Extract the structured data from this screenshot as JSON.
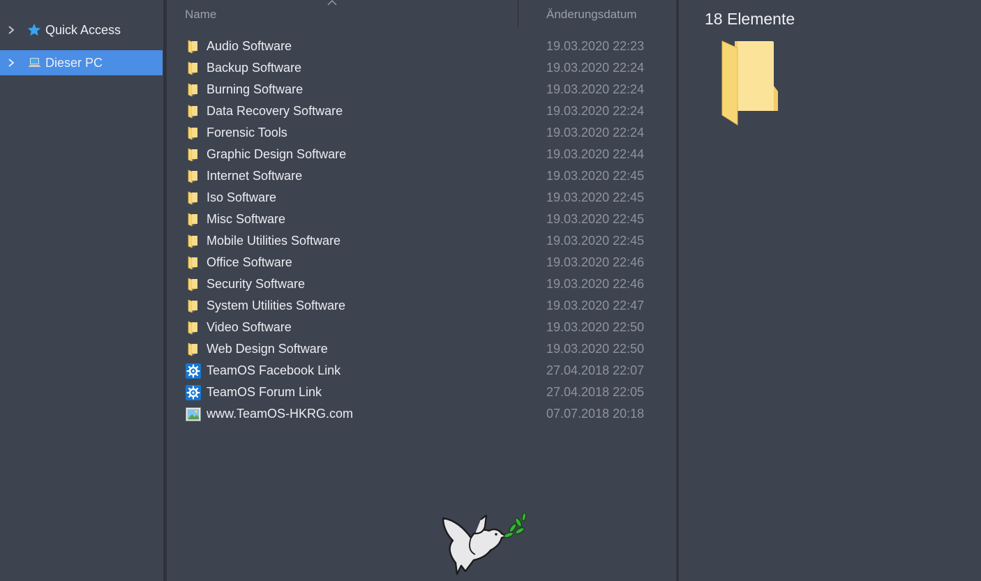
{
  "sidebar": {
    "items": [
      {
        "label": "Quick Access",
        "icon": "star-icon",
        "selected": false
      },
      {
        "label": "Dieser PC",
        "icon": "computer-icon",
        "selected": true
      }
    ]
  },
  "list": {
    "columns": {
      "name": "Name",
      "date": "Änderungsdatum"
    },
    "rows": [
      {
        "name": "Audio Software",
        "date": "19.03.2020 22:23",
        "type": "folder"
      },
      {
        "name": "Backup Software",
        "date": "19.03.2020 22:24",
        "type": "folder"
      },
      {
        "name": "Burning Software",
        "date": "19.03.2020 22:24",
        "type": "folder"
      },
      {
        "name": "Data Recovery Software",
        "date": "19.03.2020 22:24",
        "type": "folder"
      },
      {
        "name": "Forensic Tools",
        "date": "19.03.2020 22:24",
        "type": "folder"
      },
      {
        "name": "Graphic Design Software",
        "date": "19.03.2020 22:44",
        "type": "folder"
      },
      {
        "name": "Internet Software",
        "date": "19.03.2020 22:45",
        "type": "folder"
      },
      {
        "name": "Iso Software",
        "date": "19.03.2020 22:45",
        "type": "folder"
      },
      {
        "name": "Misc Software",
        "date": "19.03.2020 22:45",
        "type": "folder"
      },
      {
        "name": "Mobile Utilities Software",
        "date": "19.03.2020 22:45",
        "type": "folder"
      },
      {
        "name": "Office Software",
        "date": "19.03.2020 22:46",
        "type": "folder"
      },
      {
        "name": "Security Software",
        "date": "19.03.2020 22:46",
        "type": "folder"
      },
      {
        "name": "System Utilities Software",
        "date": "19.03.2020 22:47",
        "type": "folder"
      },
      {
        "name": "Video Software",
        "date": "19.03.2020 22:50",
        "type": "folder"
      },
      {
        "name": "Web Design Software",
        "date": "19.03.2020 22:50",
        "type": "folder"
      },
      {
        "name": "TeamOS Facebook Link",
        "date": "27.04.2018 22:07",
        "type": "gear-link"
      },
      {
        "name": "TeamOS Forum Link",
        "date": "27.04.2018 22:05",
        "type": "gear-link"
      },
      {
        "name": "www.TeamOS-HKRG.com",
        "date": "07.07.2018 20:18",
        "type": "image"
      }
    ]
  },
  "details": {
    "count_label": "18 Elemente",
    "preview_icon": "folder-icon"
  },
  "colors": {
    "background": "#3e4350",
    "selection": "#4a8ee6",
    "folder": "#f7d774",
    "link_icon": "#1577d4",
    "date_text": "#8d939e"
  }
}
